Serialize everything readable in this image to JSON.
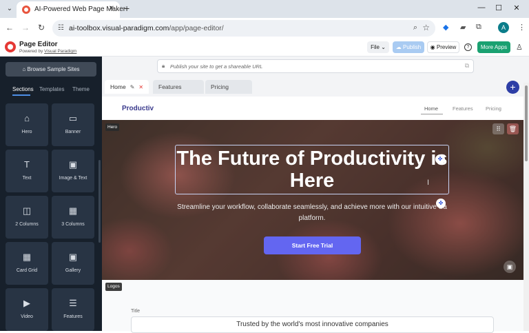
{
  "browser": {
    "tab_title": "AI-Powered Web Page Maker",
    "url_host": "ai-toolbox.visual-paradigm.com",
    "url_path": "/app/page-editor/",
    "profile_initial": "A"
  },
  "header": {
    "title": "Page Editor",
    "powered_prefix": "Powered by ",
    "powered_link": "Visual Paradigm",
    "file_label": "File",
    "publish_label": "Publish",
    "preview_label": "Preview",
    "more_apps_label": "More Apps"
  },
  "sidebar": {
    "browse_label": "Browse Sample Sites",
    "tabs": [
      "Sections",
      "Templates",
      "Theme"
    ],
    "tiles": [
      {
        "label": "Hero",
        "icon": "home-icon"
      },
      {
        "label": "Banner",
        "icon": "banner-icon"
      },
      {
        "label": "Text",
        "icon": "text-icon"
      },
      {
        "label": "Image & Text",
        "icon": "image-icon"
      },
      {
        "label": "2 Columns",
        "icon": "two-columns-icon"
      },
      {
        "label": "3 Columns",
        "icon": "three-columns-icon"
      },
      {
        "label": "Card Grid",
        "icon": "grid-icon"
      },
      {
        "label": "Gallery",
        "icon": "gallery-icon"
      },
      {
        "label": "Video",
        "icon": "video-icon"
      },
      {
        "label": "Features",
        "icon": "features-icon"
      }
    ]
  },
  "editor": {
    "publish_hint": "Publish your site to get a shareable URL",
    "page_tabs": [
      "Home",
      "Features",
      "Pricing"
    ],
    "site": {
      "brand": "Productiv",
      "nav": [
        "Home",
        "Features",
        "Pricing"
      ]
    },
    "hero": {
      "section_label": "Hero",
      "title": "The Future of Productivity is Here",
      "subtitle": "Streamline your workflow, collaborate seamlessly, and achieve more with our intuitive Sa platform.",
      "cta": "Start Free Trial"
    },
    "logos": {
      "section_label": "Logos",
      "field_label": "Title",
      "field_value": "Trusted by the world's most innovative companies"
    }
  }
}
